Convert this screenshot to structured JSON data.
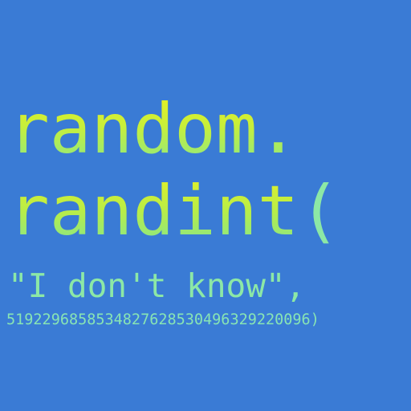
{
  "code": {
    "line1": "random.",
    "line2_a": "randint",
    "line2_b": "(",
    "line3": "\"I don't know\",",
    "line4": "5192296858534827628530496329220096)"
  },
  "colors": {
    "background": "#3a7bd5",
    "text_yellow": "#e6f024",
    "text_green": "#8ce8a6"
  }
}
